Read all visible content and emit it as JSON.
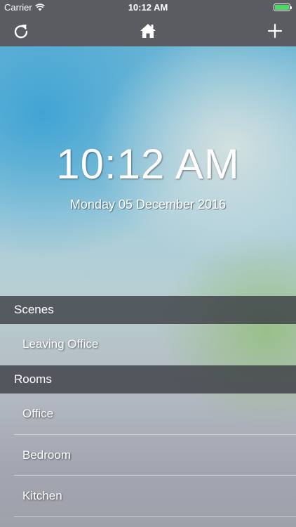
{
  "status_bar": {
    "carrier": "Carrier",
    "time": "10:12 AM",
    "battery_color": "#4cd964"
  },
  "nav_bar": {
    "left_icon": "refresh-icon",
    "center_icon": "home-icon",
    "right_icon": "plus-icon"
  },
  "clock": {
    "time": "10:12 AM",
    "date": "Monday 05 December 2016"
  },
  "scenes": {
    "header": "Scenes",
    "items": [
      {
        "label": "Leaving Office"
      }
    ]
  },
  "rooms": {
    "header": "Rooms",
    "items": [
      {
        "label": "Office"
      },
      {
        "label": "Bedroom"
      },
      {
        "label": "Kitchen"
      }
    ]
  }
}
